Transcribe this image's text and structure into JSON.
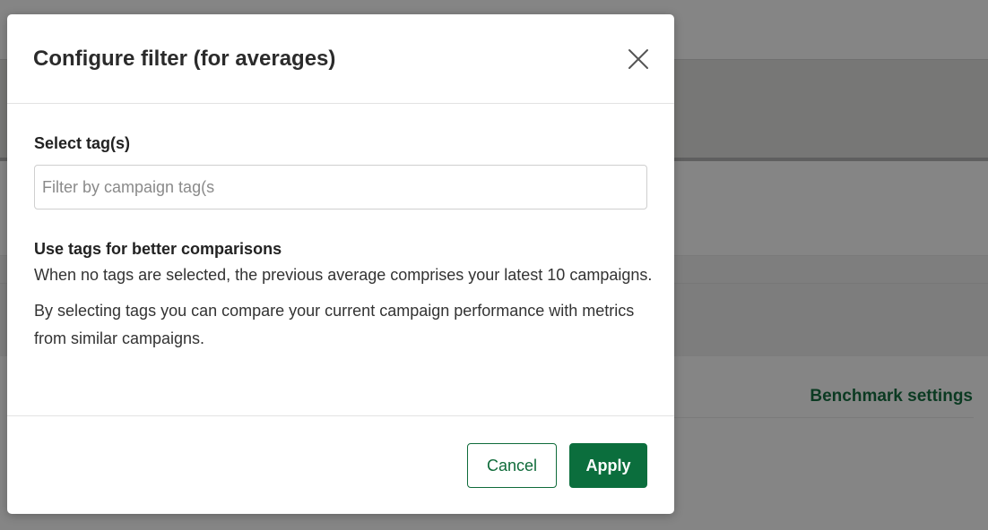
{
  "background": {
    "link_text": "Benchmark settings"
  },
  "modal": {
    "title": "Configure filter (for averages)",
    "close_icon": "close-icon",
    "field_label": "Select tag(s)",
    "input_placeholder": "Filter by campaign tag(s",
    "input_value": "",
    "info_heading": "Use tags for better comparisons",
    "info_paragraphs": [
      "When no tags are selected, the previous average comprises your latest 10 campaigns.",
      "By selecting tags you can compare your current campaign performance with metrics from similar campaigns."
    ],
    "cancel_label": "Cancel",
    "apply_label": "Apply"
  },
  "colors": {
    "accent": "#0b6e3d",
    "overlay": "#858585"
  }
}
